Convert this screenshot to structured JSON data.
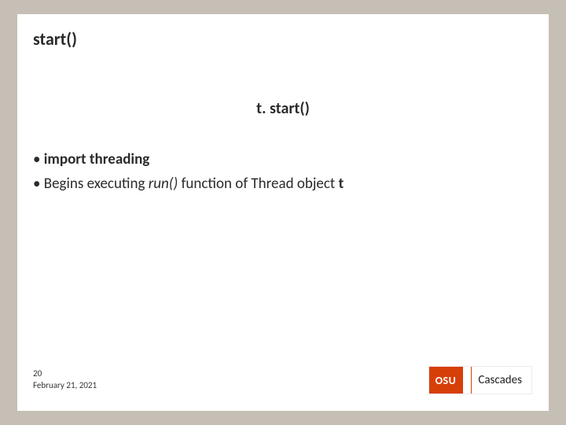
{
  "title": "start()",
  "subtitle": "t. start()",
  "bullets": {
    "item1": "import threading",
    "item2_prefix": "Begins executing ",
    "item2_run": "run()",
    "item2_mid": " function of Thread object ",
    "item2_t": "t"
  },
  "footer": {
    "page": "20",
    "date": "February 21, 2021"
  },
  "logo": {
    "osu": "OSU",
    "cascades": "Cascades"
  }
}
